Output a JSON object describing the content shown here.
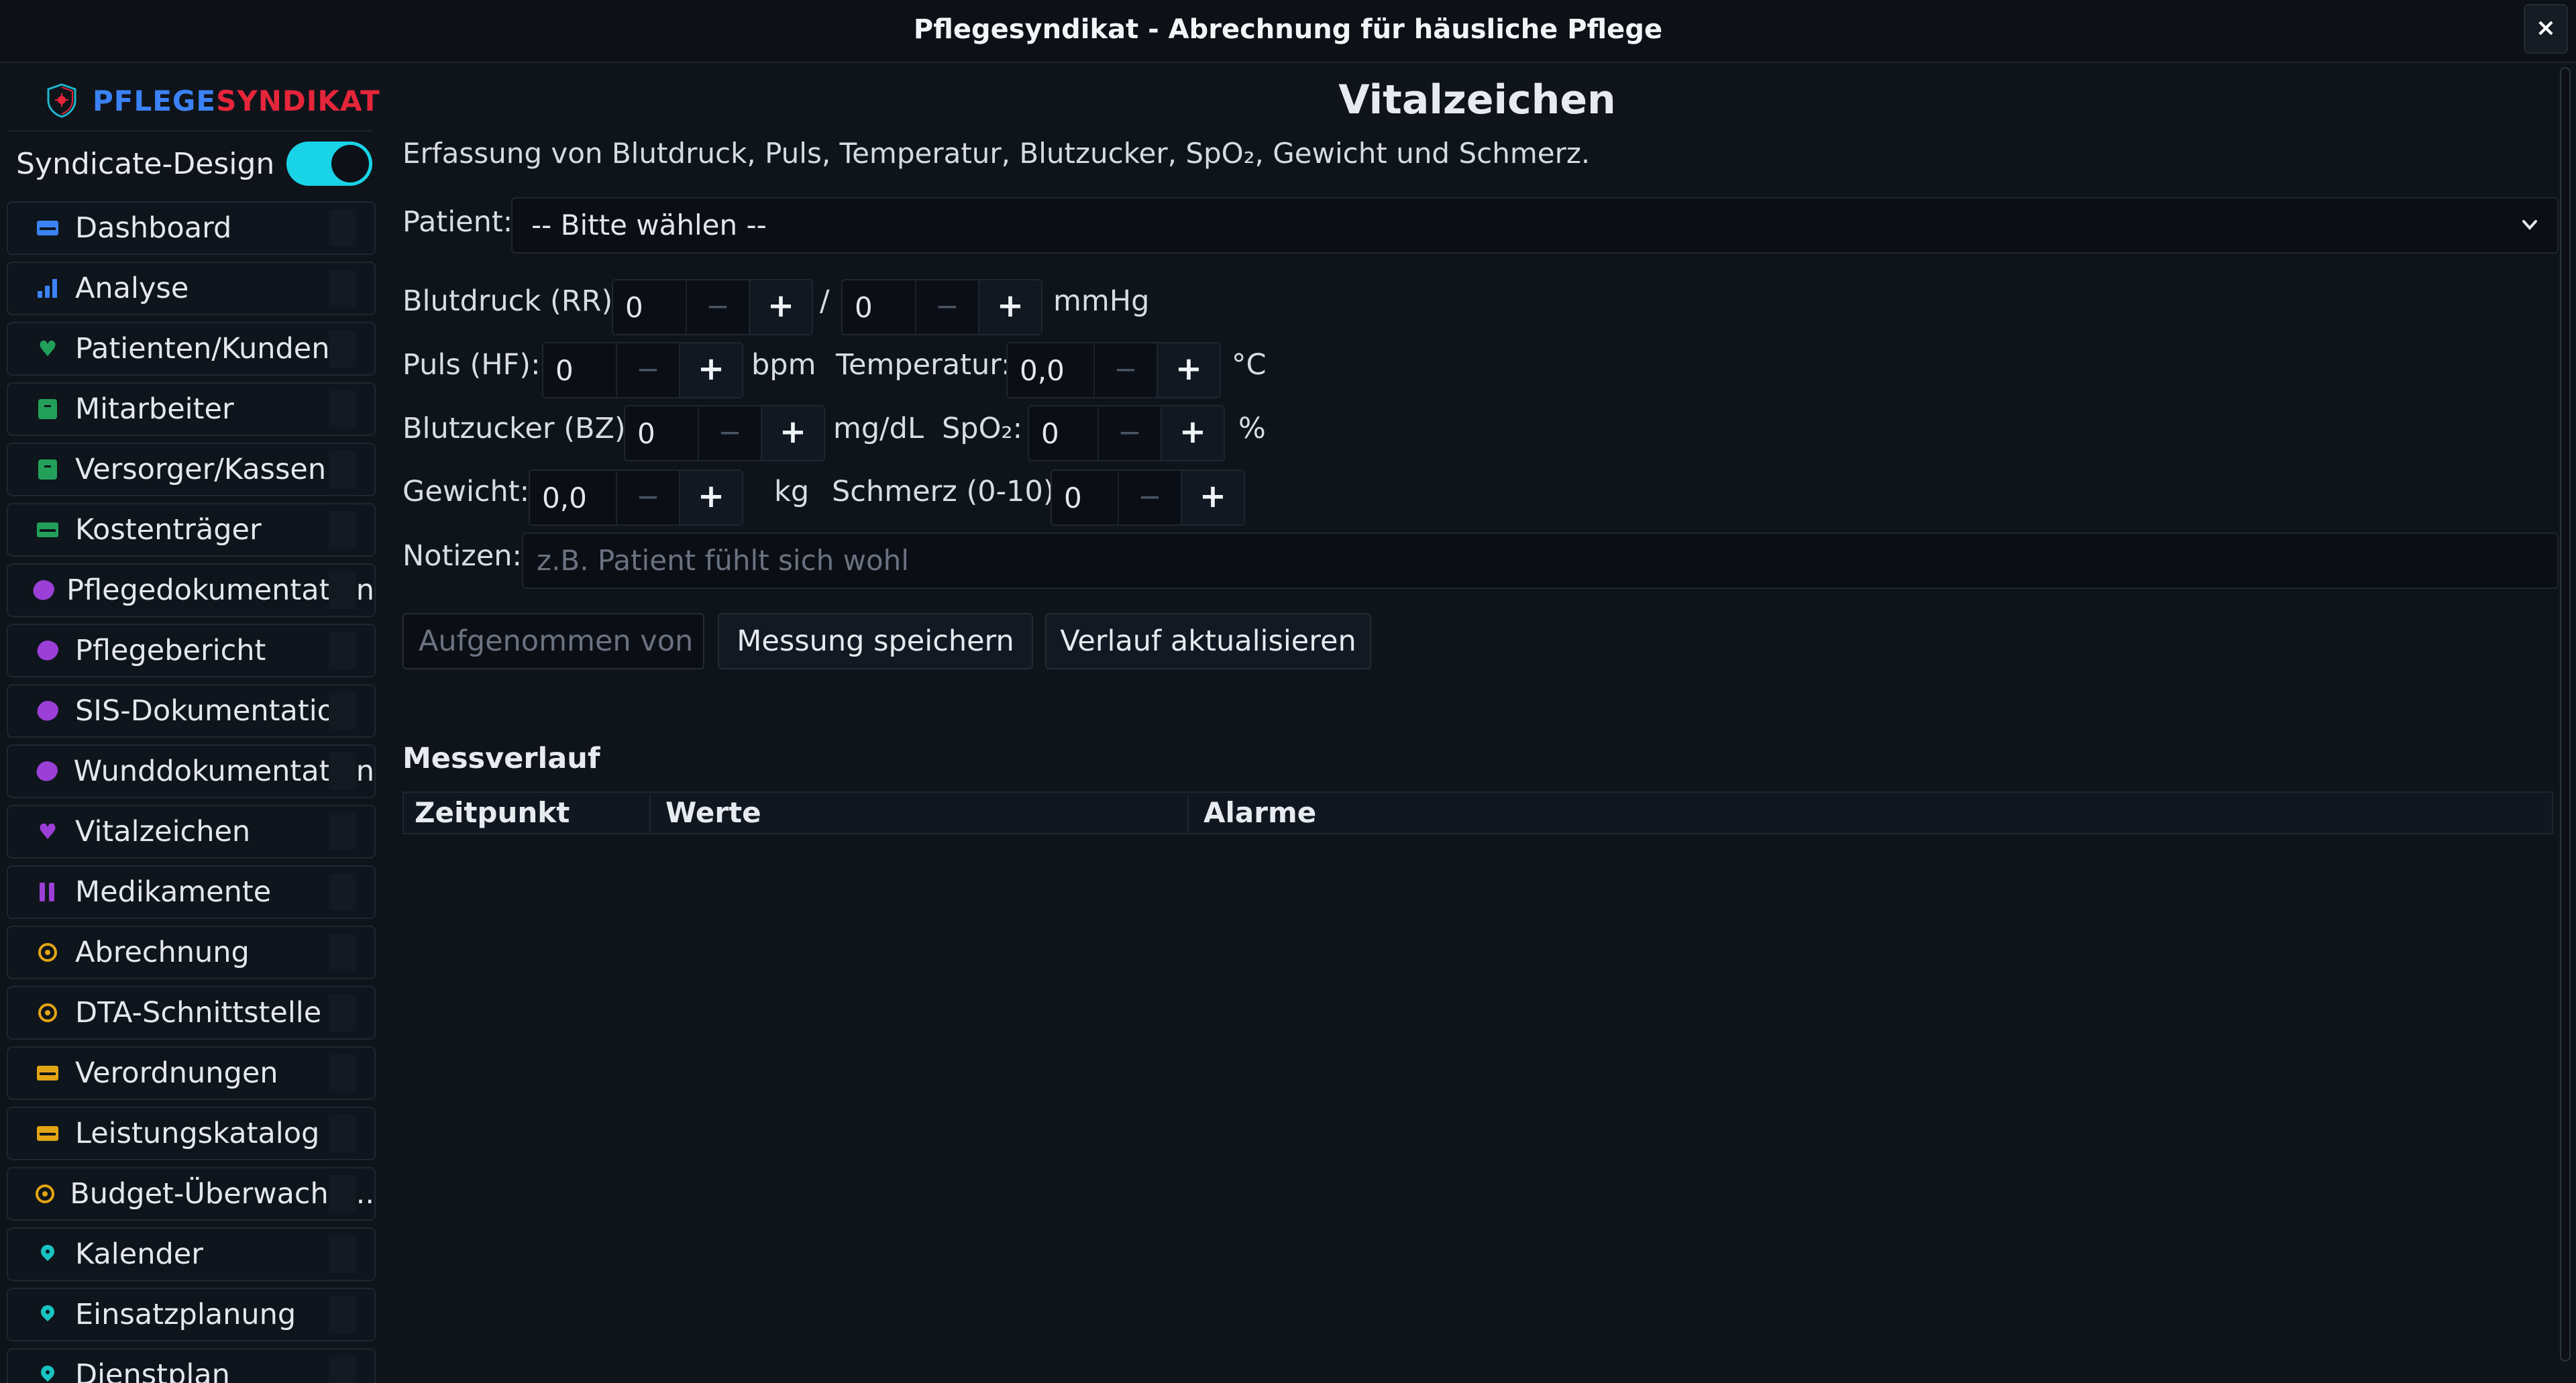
{
  "window": {
    "title": "Pflegesyndikat - Abrechnung für häusliche Pflege",
    "close_label": "×"
  },
  "sidebar": {
    "brand_part1": "PFLEGE",
    "brand_part2": "SYNDIKAT",
    "theme_toggle": {
      "label": "Syndicate-Design",
      "on": true
    },
    "items": [
      {
        "label": "Dashboard",
        "icon": "card-icon",
        "color": "#3b82f6"
      },
      {
        "label": "Analyse",
        "icon": "bar-chart-icon",
        "color": "#3b82f6"
      },
      {
        "label": "Patienten/Kunden",
        "icon": "heart-icon",
        "color": "#22a05a"
      },
      {
        "label": "Mitarbeiter",
        "icon": "briefcase-icon",
        "color": "#22a05a"
      },
      {
        "label": "Versorger/Kassen",
        "icon": "briefcase-icon",
        "color": "#22a05a"
      },
      {
        "label": "Kostenträger",
        "icon": "card-icon",
        "color": "#22a05a"
      },
      {
        "label": "Pflegedokumentation",
        "icon": "blob-icon",
        "color": "#9b3fd6"
      },
      {
        "label": "Pflegebericht",
        "icon": "blob-icon",
        "color": "#9b3fd6"
      },
      {
        "label": "SIS-Dokumentation",
        "icon": "blob-icon",
        "color": "#9b3fd6"
      },
      {
        "label": "Wunddokumentation",
        "icon": "blob-icon",
        "color": "#9b3fd6"
      },
      {
        "label": "Vitalzeichen",
        "icon": "heart-icon",
        "color": "#9b3fd6"
      },
      {
        "label": "Medikamente",
        "icon": "pause-icon",
        "color": "#9b3fd6"
      },
      {
        "label": "Abrechnung",
        "icon": "coin-icon",
        "color": "#e3a514"
      },
      {
        "label": "DTA-Schnittstelle",
        "icon": "coin-icon",
        "color": "#e3a514"
      },
      {
        "label": "Verordnungen",
        "icon": "card-icon",
        "color": "#e3a514"
      },
      {
        "label": "Leistungskatalog",
        "icon": "card-icon",
        "color": "#e3a514"
      },
      {
        "label": "Budget-Überwachu...",
        "icon": "coin-icon",
        "color": "#e3a514"
      },
      {
        "label": "Kalender",
        "icon": "pin-icon",
        "color": "#18c4c2"
      },
      {
        "label": "Einsatzplanung",
        "icon": "pin-icon",
        "color": "#18c4c2"
      },
      {
        "label": "Dienstplan",
        "icon": "pin-icon",
        "color": "#18c4c2"
      }
    ]
  },
  "main": {
    "title": "Vitalzeichen",
    "subtitle": "Erfassung von Blutdruck, Puls, Temperatur, Blutzucker, SpO₂, Gewicht und Schmerz.",
    "patient": {
      "label": "Patient:",
      "value": "-- Bitte wählen --"
    },
    "bp": {
      "label": "Blutdruck (RR):",
      "sys": "0",
      "slash": "/",
      "dia": "0",
      "unit": "mmHg"
    },
    "pulse": {
      "label": "Puls (HF):",
      "value": "0",
      "unit": "bpm"
    },
    "temp": {
      "label": "Temperatur:",
      "value": "0,0",
      "unit": "°C"
    },
    "glucose": {
      "label": "Blutzucker (BZ):",
      "value": "0",
      "unit": "mg/dL"
    },
    "spo2": {
      "label": "SpO₂:",
      "value": "0",
      "unit": "%"
    },
    "weight": {
      "label": "Gewicht:",
      "value": "0,0",
      "unit": "kg"
    },
    "pain": {
      "label": "Schmerz (0-10):",
      "value": "0"
    },
    "notes": {
      "label": "Notizen:",
      "placeholder": "z.B. Patient fühlt sich wohl"
    },
    "recorded_by_placeholder": "Aufgenommen von",
    "save_label": "Messung speichern",
    "refresh_label": "Verlauf aktualisieren",
    "history": {
      "title": "Messverlauf",
      "columns": [
        "Zeitpunkt",
        "Werte",
        "Alarme"
      ]
    },
    "stepper": {
      "minus": "−",
      "plus": "+"
    }
  }
}
